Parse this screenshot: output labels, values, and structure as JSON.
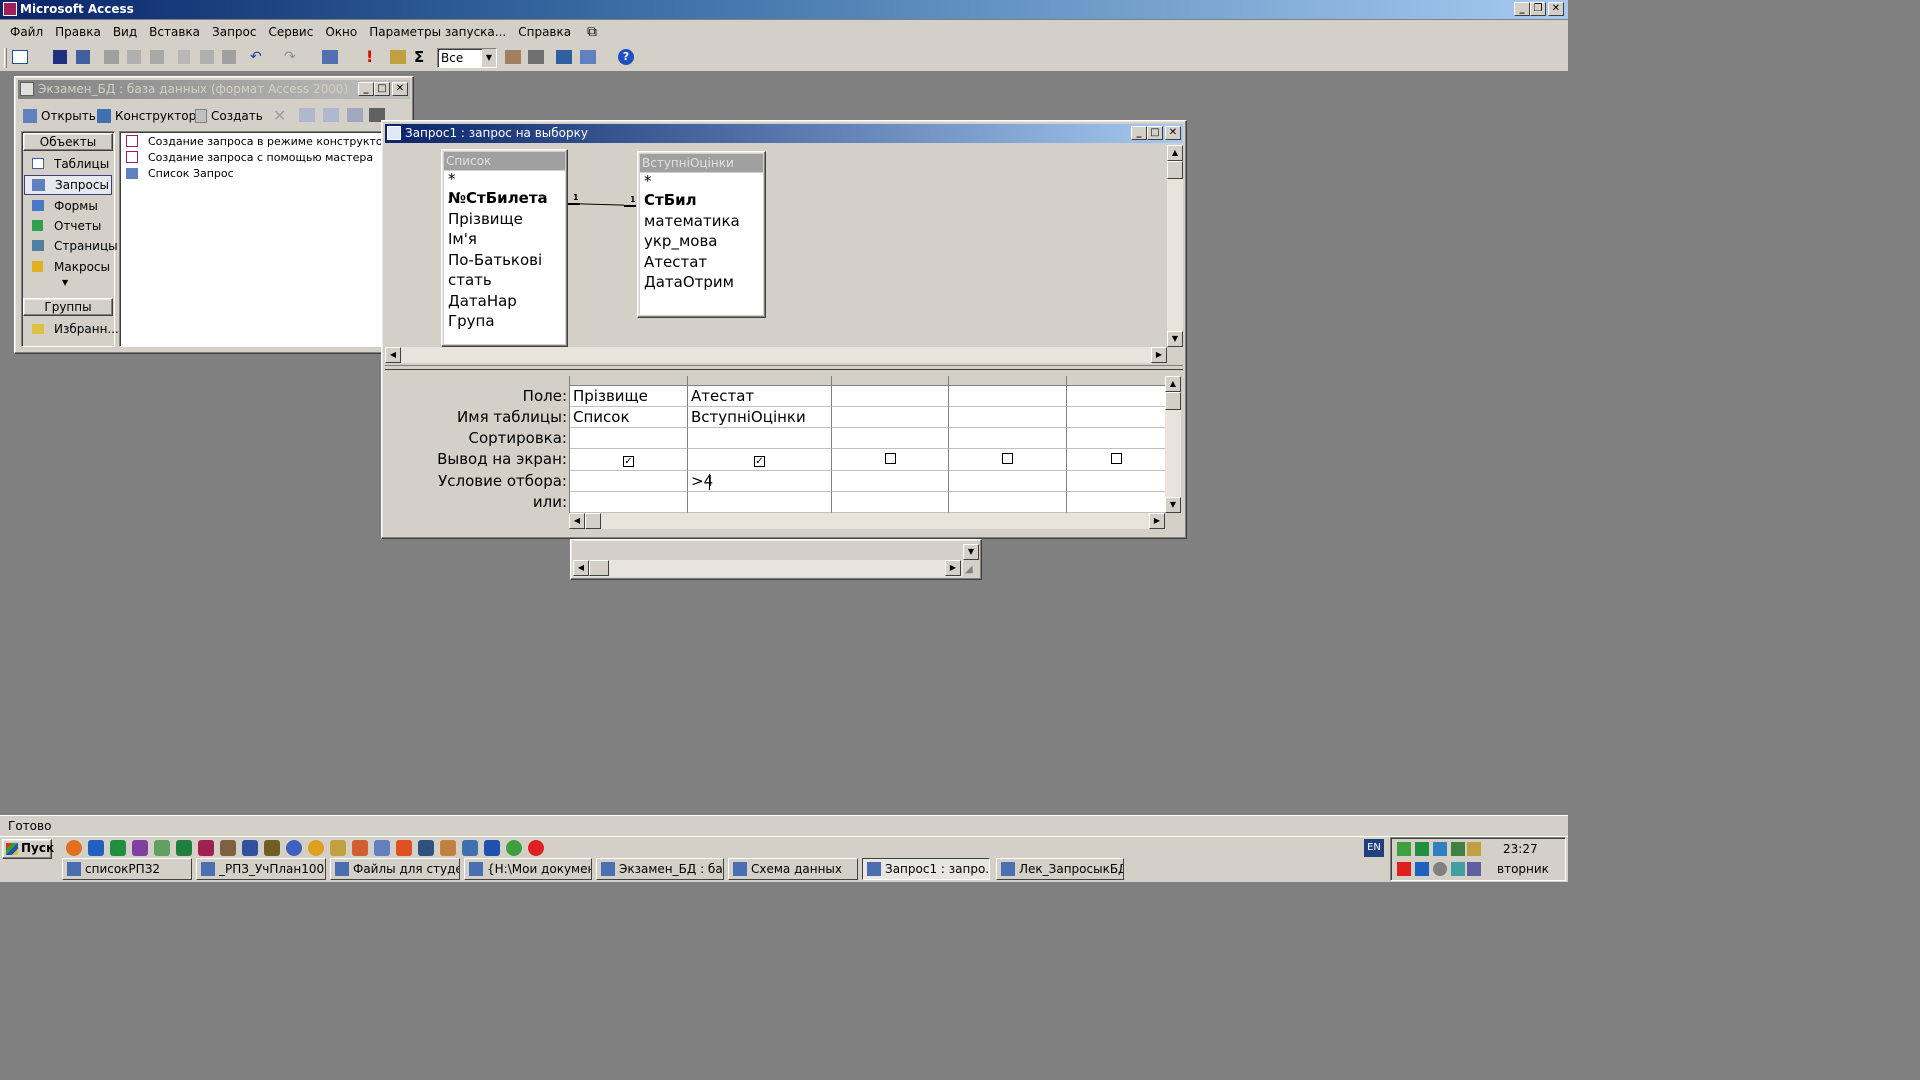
{
  "app": {
    "title": "Microsoft Access",
    "status": "Готово"
  },
  "menu": [
    "Файл",
    "Правка",
    "Вид",
    "Вставка",
    "Запрос",
    "Сервис",
    "Окно",
    "Параметры запуска...",
    "Справка"
  ],
  "toolbar": {
    "combo_value": "Все"
  },
  "db_window": {
    "title": "Экзамен_БД : база данных (формат Access 2000)",
    "buttons": {
      "open": "Открыть",
      "design": "Конструктор",
      "create": "Создать"
    },
    "objects_header": "Объекты",
    "objects": [
      "Таблицы",
      "Запросы",
      "Формы",
      "Отчеты",
      "Страницы",
      "Макросы"
    ],
    "groups_header": "Группы",
    "groups": [
      "Избранн..."
    ],
    "items": [
      "Создание запроса в режиме конструктора",
      "Создание запроса с помощью мастера",
      "Список Запрос"
    ]
  },
  "query_window": {
    "title": "Запрос1 : запрос на выборку",
    "tables": [
      {
        "name": "Список",
        "fields": [
          "*",
          "№СтБилета",
          "Прізвище",
          "Ім'я",
          "По-Батькові",
          "стать",
          "ДатаНар",
          "Група"
        ]
      },
      {
        "name": "ВступніОцінки",
        "fields": [
          "*",
          "СтБил",
          "математика",
          "укр_мова",
          "Атестат",
          "ДатаОтрим"
        ]
      }
    ],
    "relation_labels": [
      "1",
      "1"
    ],
    "row_labels": [
      "Поле:",
      "Имя таблицы:",
      "Сортировка:",
      "Вывод на экран:",
      "Условие отбора:",
      "или:"
    ],
    "columns": [
      {
        "field": "Прізвище",
        "table": "Список",
        "sort": "",
        "show": true,
        "criteria": "",
        "or": ""
      },
      {
        "field": "Атестат",
        "table": "ВступніОцінки",
        "sort": "",
        "show": true,
        "criteria": ">4",
        "or": ""
      },
      {
        "field": "",
        "table": "",
        "sort": "",
        "show": false,
        "criteria": "",
        "or": ""
      },
      {
        "field": "",
        "table": "",
        "sort": "",
        "show": false,
        "criteria": "",
        "or": ""
      },
      {
        "field": "",
        "table": "",
        "sort": "",
        "show": false,
        "criteria": "",
        "or": ""
      }
    ]
  },
  "taskbar": {
    "start": "Пуск",
    "lang": "EN",
    "time": "23:27",
    "day": "вторник",
    "tasks": [
      "списокРПЗ2",
      "_РПЗ_УчПлан100...",
      "Файлы для студе...",
      "{H:\\Мои докумен...",
      "Экзамен_БД : баз...",
      "Схема данных",
      "Запрос1 : запро...",
      "Лек_ЗапросыкБД ..."
    ]
  }
}
